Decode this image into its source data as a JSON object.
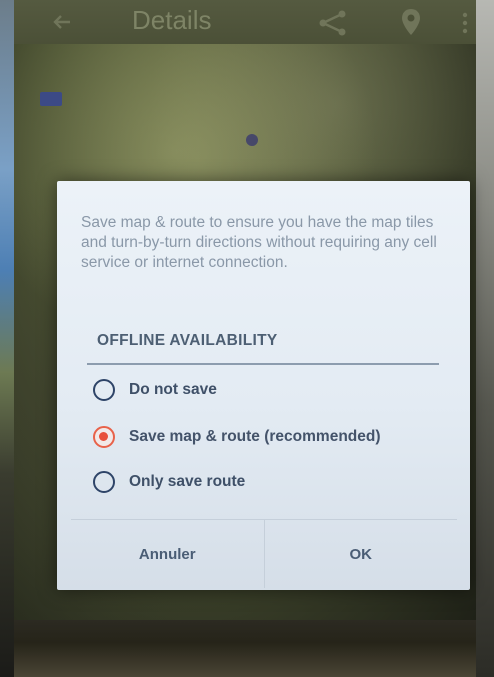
{
  "app_bar": {
    "title": "Details",
    "back_icon": "arrow-back-icon",
    "share_icon": "share-icon",
    "pin_icon": "place-pin-icon",
    "more_icon": "more-vert-icon"
  },
  "dialog": {
    "message": "Save map & route to ensure you have the map tiles and turn-by-turn directions without requiring any cell service or internet connection.",
    "section_header": "OFFLINE AVAILABILITY",
    "options": [
      {
        "label": "Do not save",
        "selected": false
      },
      {
        "label": "Save map & route (recommended)",
        "selected": true
      },
      {
        "label": "Only save route",
        "selected": false
      }
    ],
    "buttons": {
      "cancel": "Annuler",
      "ok": "OK"
    }
  },
  "colors": {
    "accent_selected_radio": "#e8503a",
    "radio_unselected": "#2e4468",
    "dialog_background": "#e3ebf3"
  }
}
